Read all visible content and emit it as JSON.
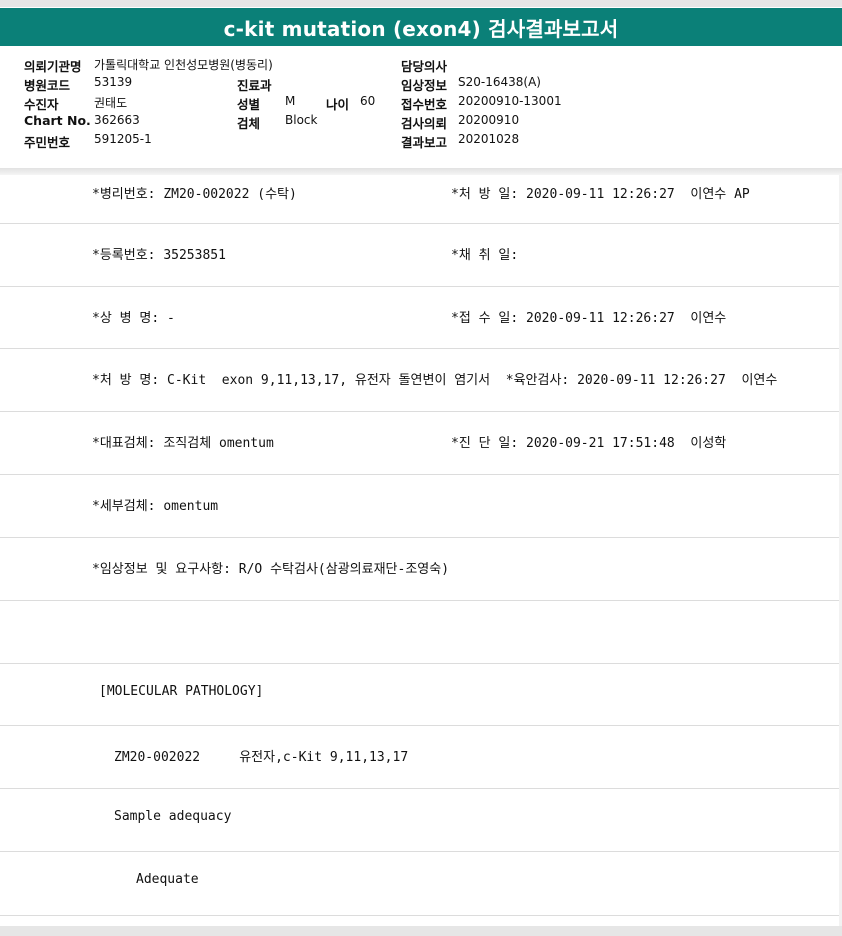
{
  "report": {
    "title": "c-kit mutation (exon4) 검사결과보고서"
  },
  "header": {
    "left": [
      {
        "label": "의뢰기관명",
        "value": "가톨릭대학교 인천성모병원(병동리)"
      },
      {
        "label": "병원코드",
        "value": "53139"
      },
      {
        "label": "수진자",
        "value": "권태도"
      },
      {
        "label": "Chart No.",
        "value": "362663"
      },
      {
        "label": "주민번호",
        "value": "591205-1"
      }
    ],
    "middle": {
      "dept_label": "진료과",
      "dept_value": "",
      "sex_label": "성별",
      "sex_value": "M",
      "age_label": "나이",
      "age_value": "60",
      "specimen_label": "검체",
      "specimen_value": "Block"
    },
    "right": [
      {
        "label": "담당의사",
        "value": ""
      },
      {
        "label": "임상정보",
        "value": "S20-16438(A)"
      },
      {
        "label": "접수번호",
        "value": "20200910-13001"
      },
      {
        "label": "검사의뢰",
        "value": "20200910"
      },
      {
        "label": "결과보고",
        "value": "20201028"
      }
    ]
  },
  "rows": [
    {
      "left": "*병리번호: ZM20-002022 (수탁)",
      "right": "*처 방 일: 2020-09-11 12:26:27  이연수 AP"
    },
    {
      "left": "*등록번호: 35253851",
      "right": "*채 취 일:"
    },
    {
      "left": "*상 병 명: -",
      "right": "*접 수 일: 2020-09-11 12:26:27  이연수"
    },
    {
      "left": "*처 방 명: C-Kit  exon 9,11,13,17, 유전자 돌연변이 염기서  *육안검사: 2020-09-11 12:26:27  이연수",
      "right": ""
    },
    {
      "left": "*대표검체: 조직검체 omentum",
      "right": "*진 단 일: 2020-09-21 17:51:48  이성학"
    },
    {
      "left": "*세부검체: omentum",
      "right": ""
    },
    {
      "left": "*임상정보 및 요구사항: R/O 수탁검사(삼광의료재단-조영숙)",
      "right": ""
    },
    {
      "left": "",
      "right": ""
    },
    {
      "left": "[MOLECULAR PATHOLOGY]",
      "right": ""
    },
    {
      "left": "ZM20-002022     유전자,c-Kit 9,11,13,17",
      "right": ""
    },
    {
      "left": "Sample adequacy",
      "right": ""
    },
    {
      "left": "Adequate",
      "right": ""
    }
  ]
}
